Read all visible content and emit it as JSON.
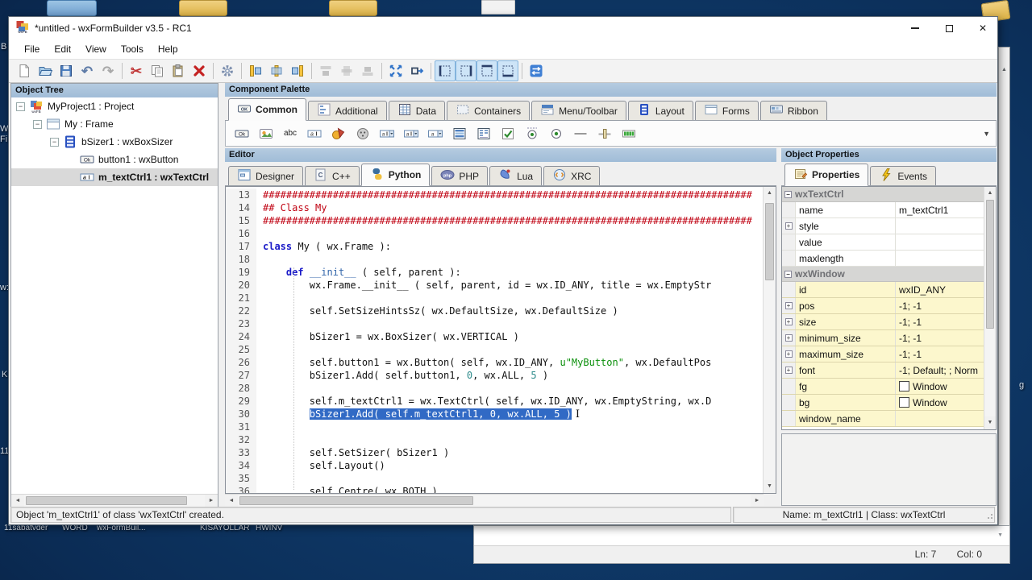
{
  "desktop": {
    "edge_labels": [
      "B",
      "W",
      "Fi",
      "w:",
      "K",
      "11"
    ],
    "right_label": "g",
    "bottom_labels": [
      "11sabatvder",
      "WORD",
      "wxFormBuil...",
      "KISAYOLLAR",
      "HWINV"
    ]
  },
  "background_window": {
    "status_ln": "Ln: 7",
    "status_col": "Col: 0"
  },
  "window": {
    "title": "*untitled - wxFormBuilder v3.5 - RC1",
    "menus": [
      "File",
      "Edit",
      "View",
      "Tools",
      "Help"
    ],
    "toolbar": [
      "new",
      "open",
      "save",
      "undo",
      "redo",
      "sep",
      "cut",
      "copy",
      "paste",
      "delete",
      "sep",
      "gear",
      "sep",
      "align-left",
      "align-center",
      "align-right",
      "sep",
      "align-top",
      "align-middle",
      "align-bottom",
      "sep",
      "expand",
      "stretch",
      "sep",
      "border-left",
      "border-right",
      "border-top",
      "border-bottom",
      "sep",
      "orient"
    ],
    "toolbar_disabled": [
      "align-top",
      "align-middle",
      "align-bottom"
    ],
    "toolbar_toggled": [
      "border-left",
      "border-right",
      "border-top",
      "border-bottom"
    ]
  },
  "object_tree": {
    "header": "Object Tree",
    "items": [
      {
        "label": "MyProject1 : Project",
        "icon": "project",
        "depth": 0,
        "expander": true,
        "selected": false
      },
      {
        "label": "My : Frame",
        "icon": "frame",
        "depth": 1,
        "expander": true,
        "selected": false
      },
      {
        "label": "bSizer1 : wxBoxSizer",
        "icon": "sizer",
        "depth": 2,
        "expander": true,
        "selected": false
      },
      {
        "label": "button1 : wxButton",
        "icon": "button",
        "depth": 3,
        "expander": false,
        "selected": false
      },
      {
        "label": "m_textCtrl1 : wxTextCtrl",
        "icon": "textctrl",
        "depth": 3,
        "expander": false,
        "selected": true
      }
    ]
  },
  "palette": {
    "header": "Component Palette",
    "tabs": [
      {
        "label": "Common",
        "icon": "tab-common",
        "selected": true
      },
      {
        "label": "Additional",
        "icon": "tab-additional",
        "selected": false
      },
      {
        "label": "Data",
        "icon": "tab-data",
        "selected": false
      },
      {
        "label": "Containers",
        "icon": "tab-containers",
        "selected": false
      },
      {
        "label": "Menu/Toolbar",
        "icon": "tab-menu",
        "selected": false
      },
      {
        "label": "Layout",
        "icon": "tab-layout",
        "selected": false
      },
      {
        "label": "Forms",
        "icon": "tab-forms",
        "selected": false
      },
      {
        "label": "Ribbon",
        "icon": "tab-ribbon",
        "selected": false
      }
    ],
    "tools": [
      "tool-button",
      "tool-bitmapbutton",
      "tool-statictext",
      "tool-textctrl",
      "tool-colors",
      "tool-toggle",
      "tool-combo",
      "tool-bitmapcombo",
      "tool-choice",
      "tool-listbox",
      "tool-listctrl",
      "tool-checkbox",
      "tool-radiobox",
      "tool-radio",
      "tool-staticline",
      "tool-slider",
      "tool-gauge"
    ]
  },
  "editor": {
    "header": "Editor",
    "tabs": [
      {
        "label": "Designer",
        "icon": "tab-designer",
        "selected": false
      },
      {
        "label": "C++",
        "icon": "tab-cpp",
        "selected": false
      },
      {
        "label": "Python",
        "icon": "tab-python",
        "selected": true
      },
      {
        "label": "PHP",
        "icon": "tab-php",
        "selected": false
      },
      {
        "label": "Lua",
        "icon": "tab-lua",
        "selected": false
      },
      {
        "label": "XRC",
        "icon": "tab-xrc",
        "selected": false
      }
    ],
    "code": [
      {
        "n": "13",
        "parts": [
          [
            "com",
            "####################################################################################"
          ]
        ]
      },
      {
        "n": "14",
        "parts": [
          [
            "com",
            "## Class My"
          ]
        ]
      },
      {
        "n": "15",
        "parts": [
          [
            "com",
            "####################################################################################"
          ]
        ]
      },
      {
        "n": "16",
        "parts": []
      },
      {
        "n": "17",
        "parts": [
          [
            "kw",
            "class"
          ],
          [
            "pl",
            " My ( wx.Frame ):"
          ]
        ]
      },
      {
        "n": "18",
        "parts": []
      },
      {
        "n": "19",
        "parts": [
          [
            "pl",
            "    "
          ],
          [
            "kw",
            "def"
          ],
          [
            "pl",
            " "
          ],
          [
            "df",
            "__init__"
          ],
          [
            "pl",
            " ( self, parent ):"
          ]
        ]
      },
      {
        "n": "20",
        "parts": [
          [
            "pl",
            "        wx.Frame.__init__ ( self, parent, id = wx.ID_ANY, title = wx.EmptyStr"
          ]
        ]
      },
      {
        "n": "21",
        "parts": []
      },
      {
        "n": "22",
        "parts": [
          [
            "pl",
            "        self.SetSizeHintsSz( wx.DefaultSize, wx.DefaultSize )"
          ]
        ]
      },
      {
        "n": "23",
        "parts": []
      },
      {
        "n": "24",
        "parts": [
          [
            "pl",
            "        bSizer1 = wx.BoxSizer( wx.VERTICAL )"
          ]
        ]
      },
      {
        "n": "25",
        "parts": []
      },
      {
        "n": "26",
        "parts": [
          [
            "pl",
            "        self.button1 = wx.Button( self, wx.ID_ANY, "
          ],
          [
            "str",
            "u\"MyButton\""
          ],
          [
            "pl",
            ", wx.DefaultPos"
          ]
        ]
      },
      {
        "n": "27",
        "parts": [
          [
            "pl",
            "        bSizer1.Add( self.button1, "
          ],
          [
            "num",
            "0"
          ],
          [
            "pl",
            ", wx.ALL, "
          ],
          [
            "num",
            "5"
          ],
          [
            "pl",
            " )"
          ]
        ]
      },
      {
        "n": "28",
        "parts": []
      },
      {
        "n": "29",
        "parts": [
          [
            "pl",
            "        self.m_textCtrl1 = wx.TextCtrl( self, wx.ID_ANY, wx.EmptyString, wx.D"
          ]
        ]
      },
      {
        "n": "30",
        "parts": [
          [
            "pl",
            "        "
          ],
          [
            "sel",
            "bSizer1.Add( self.m_textCtrl1, 0, wx.ALL, 5 )"
          ]
        ],
        "cursor": true
      },
      {
        "n": "31",
        "parts": []
      },
      {
        "n": "32",
        "parts": []
      },
      {
        "n": "33",
        "parts": [
          [
            "pl",
            "        self.SetSizer( bSizer1 )"
          ]
        ]
      },
      {
        "n": "34",
        "parts": [
          [
            "pl",
            "        self.Layout()"
          ]
        ]
      },
      {
        "n": "35",
        "parts": []
      },
      {
        "n": "36",
        "parts": [
          [
            "pl",
            "        self.Centre( wx.BOTH )"
          ]
        ]
      }
    ]
  },
  "properties": {
    "header": "Object Properties",
    "tabs": [
      {
        "label": "Properties",
        "icon": "tab-props",
        "selected": true
      },
      {
        "label": "Events",
        "icon": "tab-events",
        "selected": false
      }
    ],
    "sections": [
      {
        "title": "wxTextCtrl",
        "tint": "white",
        "rows": [
          {
            "name": "name",
            "value": "m_textCtrl1",
            "expandable": false
          },
          {
            "name": "style",
            "value": "",
            "expandable": true
          },
          {
            "name": "value",
            "value": "",
            "expandable": false
          },
          {
            "name": "maxlength",
            "value": "",
            "expandable": false
          }
        ]
      },
      {
        "title": "wxWindow",
        "tint": "yellow",
        "rows": [
          {
            "name": "id",
            "value": "wxID_ANY",
            "expandable": false
          },
          {
            "name": "pos",
            "value": "-1; -1",
            "expandable": true
          },
          {
            "name": "size",
            "value": "-1; -1",
            "expandable": true
          },
          {
            "name": "minimum_size",
            "value": "-1; -1",
            "expandable": true
          },
          {
            "name": "maximum_size",
            "value": "-1; -1",
            "expandable": true
          },
          {
            "name": "font",
            "value": "-1; Default; ; Norm",
            "expandable": true
          },
          {
            "name": "fg",
            "value": "Window",
            "expandable": false,
            "swatch": "#ffffff"
          },
          {
            "name": "bg",
            "value": "Window",
            "expandable": false,
            "swatch": "#ffffff"
          },
          {
            "name": "window_name",
            "value": "",
            "expandable": false
          }
        ]
      }
    ]
  },
  "statusbar": {
    "message": "Object 'm_textCtrl1' of class 'wxTextCtrl' created.",
    "object_info": "Name: m_textCtrl1 | Class: wxTextCtrl"
  },
  "colors": {
    "selection": "#316ac5",
    "comment": "#c00414",
    "keyword": "#1a1ac8",
    "string": "#0a8f0a",
    "number": "#2e8b8b",
    "yellow_row": "#fcf7cd",
    "header_blue": "#a9c3dc"
  }
}
